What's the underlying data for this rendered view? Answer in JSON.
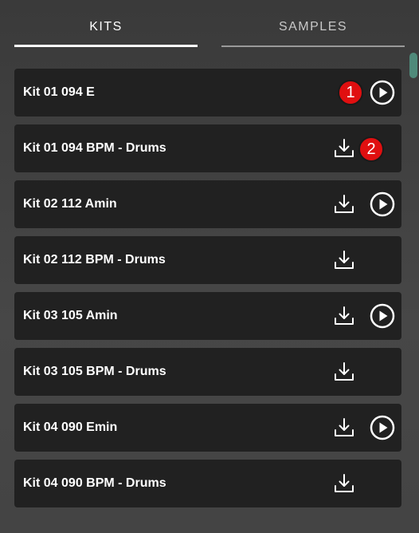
{
  "tabs": {
    "kits_label": "KITS",
    "samples_label": "SAMPLES",
    "active": "KITS"
  },
  "kits": [
    {
      "name": "Kit 01 094 E",
      "has_download": false,
      "has_play": true,
      "badge": "1"
    },
    {
      "name": "Kit 01 094 BPM - Drums",
      "has_download": true,
      "has_play": false,
      "badge": "2"
    },
    {
      "name": "Kit 02 112 Amin",
      "has_download": true,
      "has_play": true
    },
    {
      "name": "Kit 02 112 BPM - Drums",
      "has_download": true,
      "has_play": false
    },
    {
      "name": "Kit 03 105 Amin",
      "has_download": true,
      "has_play": true
    },
    {
      "name": "Kit 03 105 BPM - Drums",
      "has_download": true,
      "has_play": false
    },
    {
      "name": "Kit 04 090 Emin",
      "has_download": true,
      "has_play": true
    },
    {
      "name": "Kit 04 090 BPM - Drums",
      "has_download": true,
      "has_play": false
    }
  ],
  "icons": {
    "download": "download-icon",
    "play": "play-circle-icon"
  },
  "colors": {
    "background": "#444444",
    "row": "#212121",
    "text": "#ffffff",
    "badge": "#e00f10",
    "scrollbar": "#4f8a7a"
  }
}
